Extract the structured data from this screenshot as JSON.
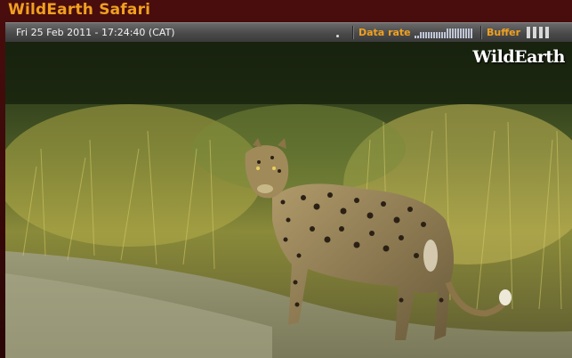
{
  "app": {
    "title": "WildEarth Safari"
  },
  "status": {
    "datetime": "Fri 25 Feb 2011 - 17:24:40 (CAT)",
    "data_rate_label": "Data rate",
    "buffer_label": "Buffer",
    "buffer_bars": 4
  },
  "video": {
    "watermark": "WildEarth"
  },
  "colors": {
    "accent": "#f0a020",
    "frame": "#3a0a0a"
  }
}
